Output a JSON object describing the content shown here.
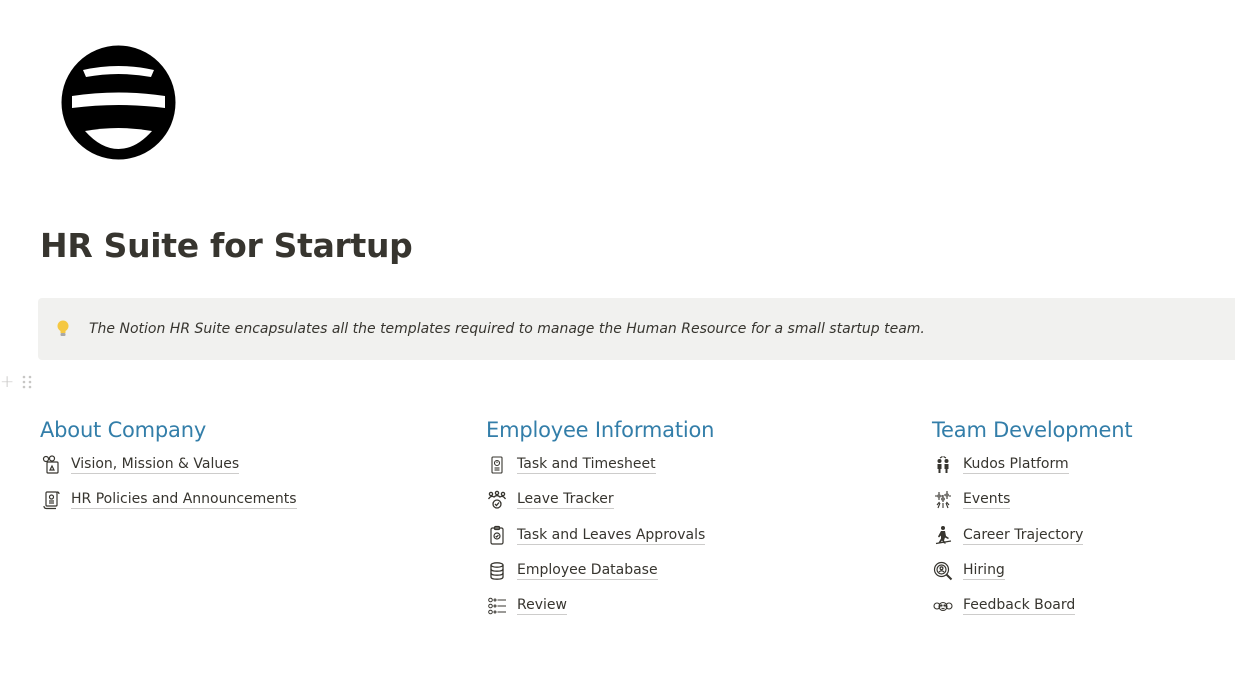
{
  "page": {
    "icon": "striped-globe-icon",
    "title": "HR Suite for Startup"
  },
  "callout": {
    "icon": "lightbulb-icon",
    "icon_color": "#f5c842",
    "text": "The Notion HR Suite encapsulates all the templates required to manage the Human Resource for a small startup team."
  },
  "block_controls": {
    "add_icon": "plus-icon",
    "drag_icon": "drag-handle-icon"
  },
  "colors": {
    "heading_blue": "#337ea9",
    "callout_bg": "#f1f1ef",
    "text": "#37352f"
  },
  "sections": [
    {
      "heading": "About Company",
      "items": [
        {
          "label": "Vision, Mission & Values",
          "icon": "vision-board-icon"
        },
        {
          "label": "HR Policies and Announcements",
          "icon": "scroll-document-icon"
        }
      ]
    },
    {
      "heading": "Employee Information",
      "items": [
        {
          "label": "Task and Timesheet",
          "icon": "timesheet-icon"
        },
        {
          "label": "Leave Tracker",
          "icon": "team-check-icon"
        },
        {
          "label": "Task and Leaves Approvals",
          "icon": "clipboard-check-icon"
        },
        {
          "label": "Employee Database",
          "icon": "database-icon"
        },
        {
          "label": "Review",
          "icon": "rating-list-icon"
        }
      ]
    },
    {
      "heading": "Team Development",
      "items": [
        {
          "label": "Kudos Platform",
          "icon": "high-five-icon"
        },
        {
          "label": "Events",
          "icon": "fireworks-icon"
        },
        {
          "label": "Career Trajectory",
          "icon": "climbing-person-icon"
        },
        {
          "label": "Hiring",
          "icon": "search-person-icon"
        },
        {
          "label": "Feedback Board",
          "icon": "feedback-faces-icon"
        }
      ]
    }
  ]
}
